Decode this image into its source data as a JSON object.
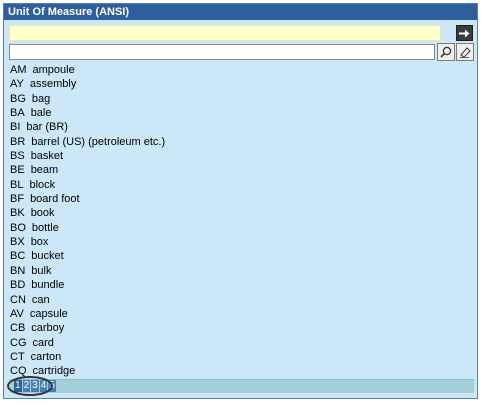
{
  "window": {
    "title": "Unit Of Measure (ANSI)"
  },
  "search": {
    "value": "",
    "placeholder": ""
  },
  "items": [
    {
      "code": "AM",
      "label": "ampoule"
    },
    {
      "code": "AY",
      "label": "assembly"
    },
    {
      "code": "BG",
      "label": "bag"
    },
    {
      "code": "BA",
      "label": "bale"
    },
    {
      "code": "BI",
      "label": "bar (BR)"
    },
    {
      "code": "BR",
      "label": "barrel (US) (petroleum etc.)"
    },
    {
      "code": "BS",
      "label": "basket"
    },
    {
      "code": "BE",
      "label": "beam"
    },
    {
      "code": "BL",
      "label": "block"
    },
    {
      "code": "BF",
      "label": "board foot"
    },
    {
      "code": "BK",
      "label": "book"
    },
    {
      "code": "BO",
      "label": "bottle"
    },
    {
      "code": "BX",
      "label": "box"
    },
    {
      "code": "BC",
      "label": "bucket"
    },
    {
      "code": "BN",
      "label": "bulk"
    },
    {
      "code": "BD",
      "label": "bundle"
    },
    {
      "code": "CN",
      "label": "can"
    },
    {
      "code": "AV",
      "label": "capsule"
    },
    {
      "code": "CB",
      "label": "carboy"
    },
    {
      "code": "CG",
      "label": "card"
    },
    {
      "code": "CT",
      "label": "carton"
    },
    {
      "code": "CQ",
      "label": "cartridge"
    }
  ],
  "pager": {
    "pages": [
      "1",
      "2",
      "3",
      "4",
      "5"
    ],
    "current": "1"
  },
  "colors": {
    "title_bg": "#2e5f9c",
    "panel_bg": "#cce8f8",
    "selected_bg": "#ffffcc",
    "pager_bg": "#a3cfd6"
  },
  "icons": {
    "go": "arrow-right-icon",
    "search": "magnifier-icon",
    "clear": "eraser-icon"
  }
}
